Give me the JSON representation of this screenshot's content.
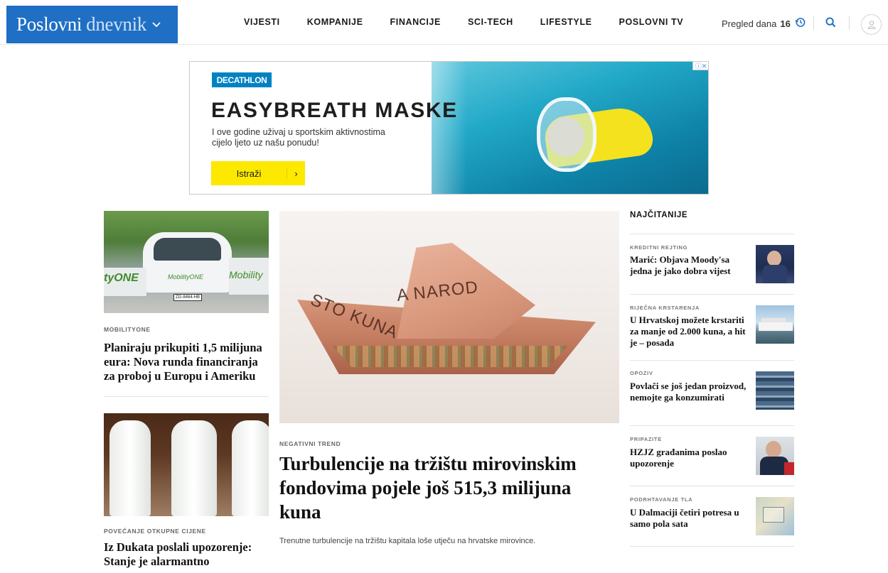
{
  "header": {
    "logo_part1": "Poslovni",
    "logo_part2": "dnevnik",
    "nav": [
      "VIJESTI",
      "KOMPANIJE",
      "FINANCIJE",
      "SCI-TECH",
      "LIFESTYLE",
      "POSLOVNI TV"
    ],
    "pregled_label": "Pregled dana",
    "pregled_count": "16",
    "accent_color": "#1f6fc4"
  },
  "ad": {
    "brand": "DECATHLON",
    "title": "EASYBREATH MASKE",
    "text": "I ove godine uživaj u sportskim aktivnostima cijelo ljeto uz našu ponudu!",
    "button": "Istraži",
    "button_arrow": "›",
    "choices": "ⓘ✕"
  },
  "left_articles": [
    {
      "kicker": "MOBILITYONE",
      "title": "Planiraju prikupiti 1,5 milijuna eura: Nova runda financiranja za proboj u Europu i Ameriku",
      "image_text1": "tyONE",
      "image_text2": "Mobility",
      "image_text3": "MobilityONE",
      "image_plate": "ZG-8464-HB"
    },
    {
      "kicker": "POVEĆANJE OTKUPNE CIJENE",
      "title": "Iz Dukata poslali upozorenje: Stanje je alarmantno"
    }
  ],
  "main_article": {
    "kicker": "NEGATIVNI TREND",
    "title": "Turbulencije na tržištu mirovinskim fondovima pojele još 515,3 milijuna kuna",
    "description": "Trenutne turbulencije na tržištu kapitala loše utječu na hrvatske mirovince.",
    "image_text1": "A NAROD",
    "image_text2": "STO KUNA"
  },
  "sidebar": {
    "heading": "NAJČITANIJE",
    "items": [
      {
        "kicker": "KREDITNI REJTING",
        "title": "Marić: Objava Moody'sa jedna je jako dobra vijest"
      },
      {
        "kicker": "RIJEČNA KRSTARENJA",
        "title": "U Hrvatskoj možete krstariti za manje od 2.000 kuna, a hit je – posada"
      },
      {
        "kicker": "OPOZIV",
        "title": "Povlači se još jedan proizvod, nemojte ga konzumirati"
      },
      {
        "kicker": "PRIPAZITE",
        "title": "HZJZ građanima poslao upozorenje"
      },
      {
        "kicker": "PODRHTAVANJE TLA",
        "title": "U Dalmaciji četiri potresa u samo pola sata"
      }
    ]
  }
}
